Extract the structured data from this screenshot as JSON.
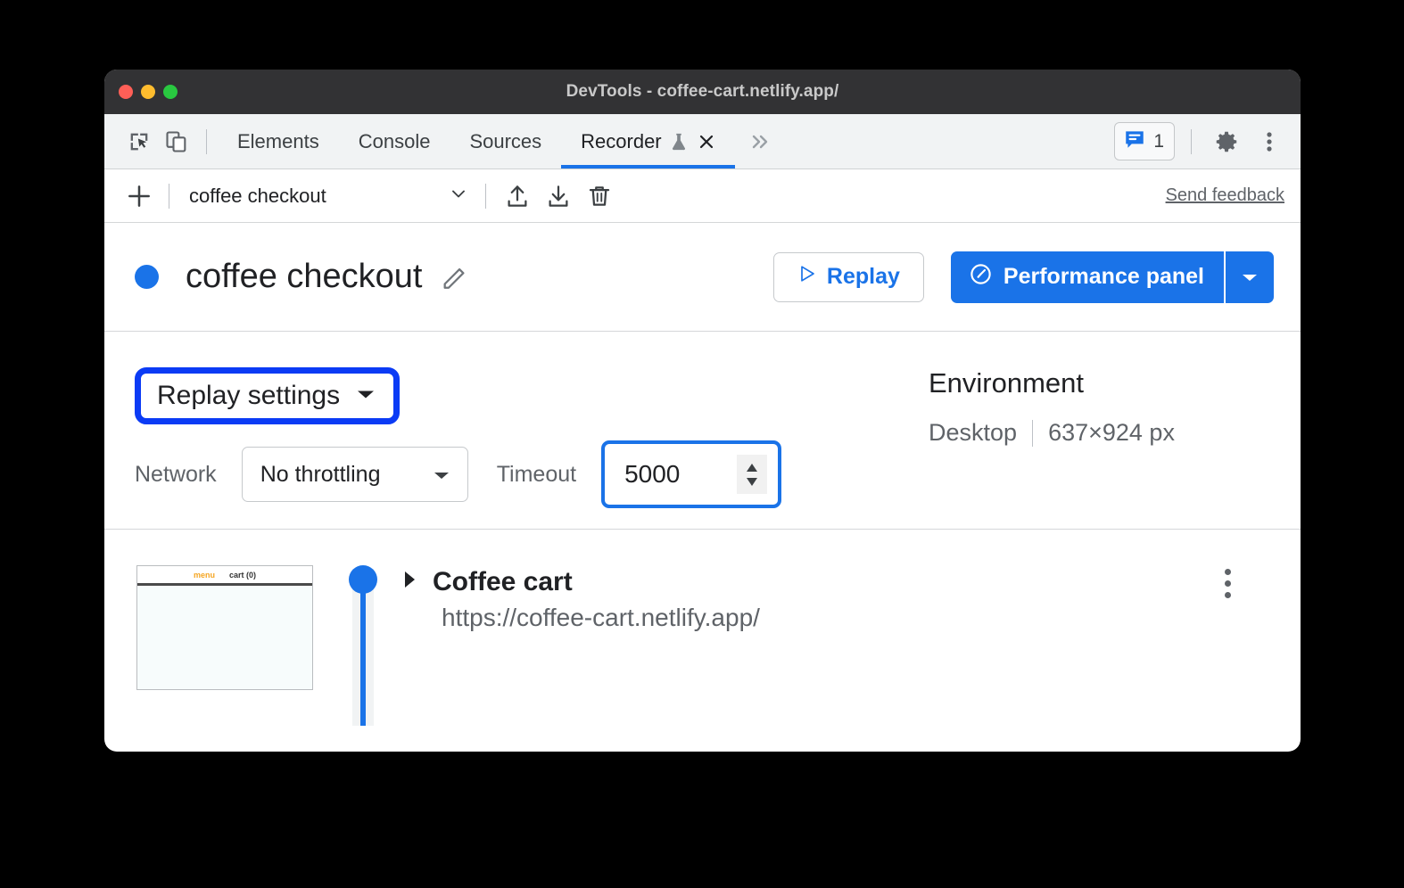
{
  "window": {
    "title": "DevTools - coffee-cart.netlify.app/",
    "traffic_lights": [
      "close",
      "minimize",
      "zoom"
    ]
  },
  "tabbar": {
    "inspect_icon": "inspect-element-icon",
    "device_icon": "device-toolbar-icon",
    "tabs": [
      {
        "label": "Elements",
        "active": false
      },
      {
        "label": "Console",
        "active": false
      },
      {
        "label": "Sources",
        "active": false
      },
      {
        "label": "Recorder",
        "active": true,
        "experiment_icon": "flask-icon",
        "closable": true
      }
    ],
    "more_tabs_icon": "chevron-double-right-icon",
    "issues": {
      "icon": "issues-bubble-icon",
      "count": "1"
    },
    "settings_icon": "gear-icon",
    "overflow_icon": "kebab-menu-icon"
  },
  "recorder_toolbar": {
    "add_icon": "plus-icon",
    "recording_name": "coffee checkout",
    "recording_caret_icon": "chevron-down-icon",
    "export_icon": "export-upload-icon",
    "import_icon": "import-download-icon",
    "delete_icon": "trash-icon",
    "feedback_label": "Send feedback"
  },
  "header": {
    "status_dot_color": "#1a73e8",
    "title": "coffee checkout",
    "edit_icon": "pencil-icon",
    "replay": {
      "label": "Replay",
      "icon": "play-triangle-icon"
    },
    "performance": {
      "label": "Performance panel",
      "icon": "performance-gauge-icon",
      "caret_icon": "caret-down-icon"
    }
  },
  "settings": {
    "toggle_label": "Replay settings",
    "toggle_caret_icon": "caret-down-icon",
    "highlight_color": "#0b3bf5",
    "network_label": "Network",
    "network_value": "No throttling",
    "network_caret_icon": "caret-down-icon",
    "timeout_label": "Timeout",
    "timeout_value": "5000",
    "timeout_spinner_icon": "stepper-arrows-icon",
    "focus_ring_color": "#1a73e8",
    "environment_heading": "Environment",
    "environment_device": "Desktop",
    "environment_viewport": "637×924 px"
  },
  "steps": [
    {
      "thumbnail": {
        "menu_text": "menu",
        "cart_text": "cart (0)"
      },
      "expand_icon": "triangle-right-icon",
      "title": "Coffee cart",
      "url": "https://coffee-cart.netlify.app/",
      "menu_icon": "kebab-menu-icon"
    }
  ]
}
